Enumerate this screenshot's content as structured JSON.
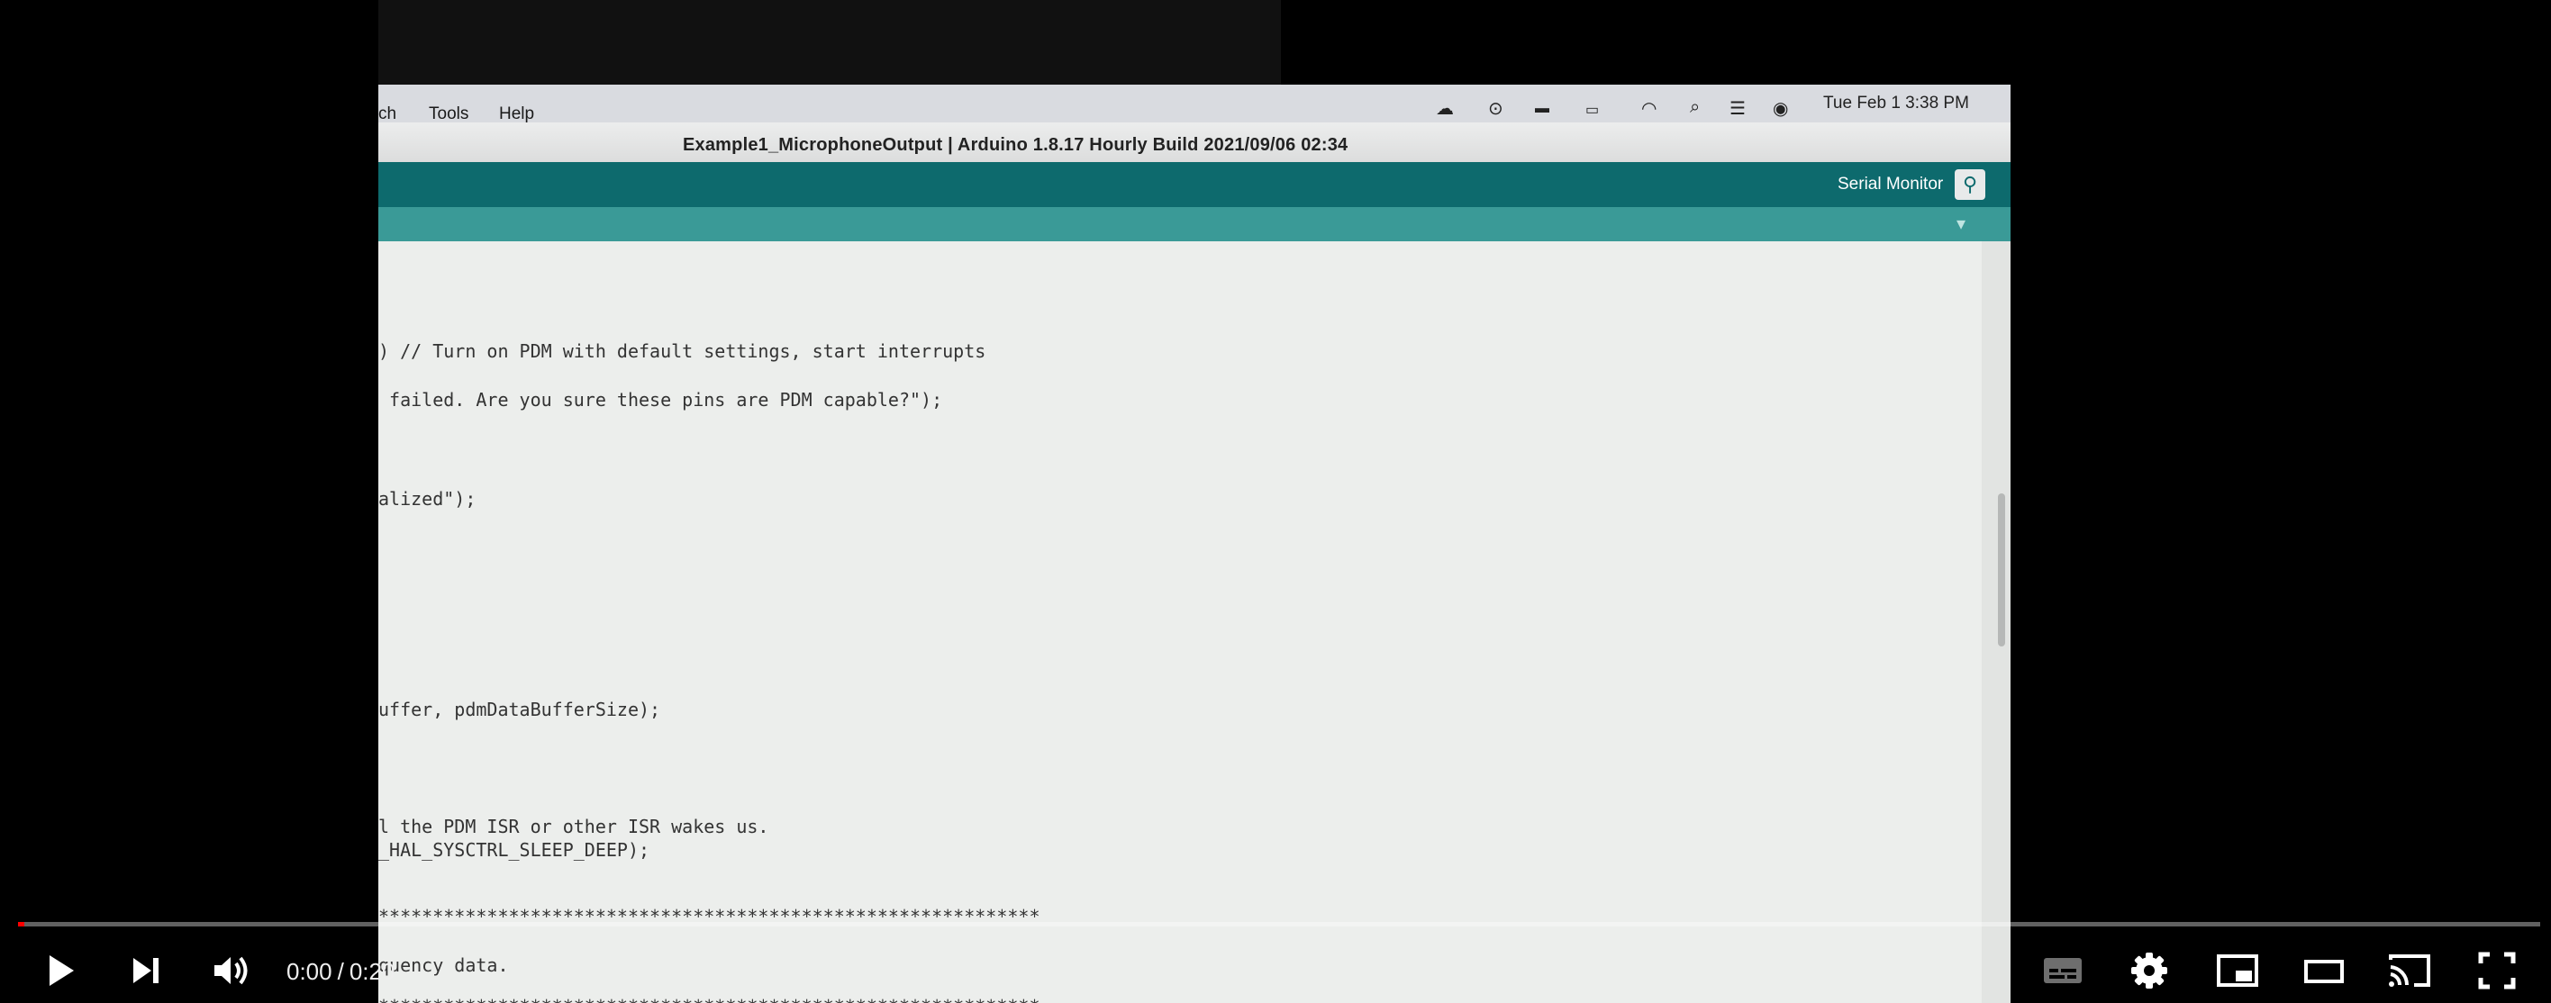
{
  "player": {
    "controls": {
      "play": "play-icon",
      "next": "next-icon",
      "mute": "volume-icon",
      "subtitles": "subtitles-icon",
      "settings": "gear-icon",
      "miniplayer": "miniplayer-icon",
      "theater": "theater-mode-icon",
      "cast": "cast-icon",
      "fullscreen": "fullscreen-icon"
    },
    "time": {
      "current": "0:00",
      "separator": "/",
      "duration": "0:20"
    },
    "progress_fraction": 0.0,
    "accent_color": "#ff0000"
  },
  "video": {
    "menubar": {
      "items": [
        "ch",
        "Tools",
        "Help"
      ],
      "clock": "Tue Feb 1  3:38 PM"
    },
    "window_title": "Example1_MicrophoneOutput | Arduino 1.8.17 Hourly Build 2021/09/06 02:34",
    "toolbar": {
      "serial_monitor_label": "Serial Monitor"
    },
    "code_lines": [
      ") // Turn on PDM with default settings, start interrupts",
      " failed. Are you sure these pins are PDM capable?\");",
      "alized\");",
      "uffer, pdmDataBufferSize);",
      "l the PDM ISR or other ISR wakes us.",
      "_HAL_SYSCTRL_SLEEP_DEEP);",
      "*************************************************************",
      "quency data.",
      "*************************************************************"
    ],
    "colors": {
      "toolbar": "#0d6a6d",
      "tabbar": "#3a9a97"
    }
  }
}
